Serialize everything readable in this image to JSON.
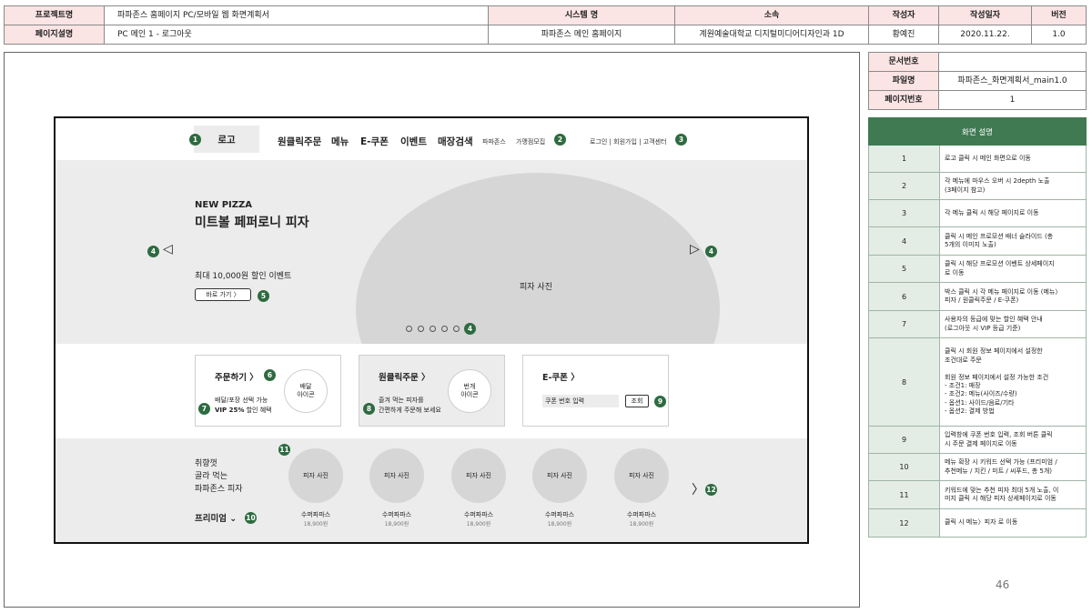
{
  "header": {
    "project_label": "프로젝트명",
    "project_value": "파파존스 홈페이지 PC/모바일 웹 화면계획서",
    "system_label": "시스템 명",
    "org_label": "소속",
    "author_label": "작성자",
    "date_label": "작성일자",
    "version_label": "버전",
    "page_label": "페이지설명",
    "page_value": "PC 메인 1 - 로그아웃",
    "system_value": "파파존스 메인 홈페이지",
    "org_value": "계원예술대학교 디지털미디어디자인과 1D",
    "author_value": "황예진",
    "date_value": "2020.11.22.",
    "version_value": "1.0"
  },
  "docinfo": {
    "doc_no_label": "문서번호",
    "doc_no_value": "",
    "file_label": "파일명",
    "file_value": "파파존스_화면계획서_main1.0",
    "page_no_label": "페이지번호",
    "page_no_value": "1"
  },
  "wireframe": {
    "nav": {
      "logo": "로고",
      "items": [
        "원클릭주문",
        "메뉴",
        "E-쿠폰",
        "이벤트",
        "매장검색"
      ],
      "small": [
        "파파존스",
        "가맹점모집"
      ],
      "util": "로그인 | 회원가입 | 고객센터"
    },
    "hero": {
      "kicker": "NEW PIZZA",
      "title": "미트볼 페퍼로니 피자",
      "subtitle": "최대 10,000원 할인 이벤트",
      "button": "바로 가기 〉",
      "photo": "피자 사진",
      "prev_arrow": "◁",
      "next_arrow": "▷"
    },
    "cards": {
      "order_title": "주문하기",
      "order_line1": "배달/포장 선택 가능",
      "order_vip": "VIP 25%",
      "order_line2_rest": " 할인 혜택",
      "order_icon": "배달\n아이콘",
      "oneclick_title": "원클릭주문",
      "oneclick_line1": "즐겨 먹는 피자를",
      "oneclick_line2": "간편하게 주문해 보세요",
      "oneclick_icon": "번개\n아이콘",
      "coupon_title": "E-쿠폰",
      "coupon_placeholder": "쿠폰 번호 입력",
      "coupon_button": "조회",
      "chevron": "〉"
    },
    "recommend": {
      "heading_lines": [
        "취향껏",
        "골라 먹는",
        "파파존스 피자"
      ],
      "filter": "프리미엄",
      "filter_arrow": "⌄",
      "next": "〉",
      "products": [
        {
          "photo": "피자 사진",
          "name": "수퍼파파스",
          "price": "18,900원"
        },
        {
          "photo": "피자 사진",
          "name": "수퍼파파스",
          "price": "18,900원"
        },
        {
          "photo": "피자 사진",
          "name": "수퍼파파스",
          "price": "18,900원"
        },
        {
          "photo": "피자 사진",
          "name": "수퍼파파스",
          "price": "18,900원"
        },
        {
          "photo": "피자 사진",
          "name": "수퍼파파스",
          "price": "18,900원"
        }
      ]
    },
    "badges": [
      "1",
      "2",
      "3",
      "4",
      "4",
      "4",
      "5",
      "6",
      "7",
      "8",
      "9",
      "10",
      "11",
      "12"
    ]
  },
  "description": {
    "title": "화면 설명",
    "rows": [
      {
        "no": "1",
        "text": "로고 클릭 시 메인 화면으로 이동"
      },
      {
        "no": "2",
        "text": "각 메뉴에 마우스 오버 시 2depth 노출\n(3페이지 참고)"
      },
      {
        "no": "3",
        "text": "각 메뉴 클릭 시 해당 페이지로 이동"
      },
      {
        "no": "4",
        "text": "클릭 시 메인 프로모션 배너 슬라이드 (총\n5개의 이미지 노출)"
      },
      {
        "no": "5",
        "text": "클릭 시 해당 프로모션 이벤트 상세페이지\n로 이동"
      },
      {
        "no": "6",
        "text": "박스 클릭 시 각 메뉴 페이지로 이동 (메뉴〉\n피자 / 원클릭주문 / E-쿠폰)"
      },
      {
        "no": "7",
        "text": "사용자의 등급에 맞는 할인 혜택 안내\n(로그아웃 시 VIP 등급 기준)"
      },
      {
        "no": "8",
        "text": "클릭 시 회원 정보 페이지에서 설정한\n조건대로 주문\n\n회원 정보 페이지에서 설정 가능한 조건\n-      조건1: 매장\n-      조건2: 메뉴(사이즈/수량)\n-      옵션1: 사이드/음료/기타\n-      옵션2: 결제 방법"
      },
      {
        "no": "9",
        "text": "입력창에 쿠폰 번호 입력, 조회 버튼 클릭\n시 주문 결제 페이지로 이동"
      },
      {
        "no": "10",
        "text": "메뉴 확장 시 키워드 선택 가능 (프리미엄 /\n추천메뉴 / 치킨 / 미트 / 씨푸드, 총 5개)"
      },
      {
        "no": "11",
        "text": "키워드에 맞는 추천 피자 최대 5개 노출, 이\n미지 클릭 시 해당 피자 상세페이지로 이동"
      },
      {
        "no": "12",
        "text": "클릭 시 메뉴〉피자 로 이동"
      }
    ]
  },
  "page_number": "46",
  "colors": {
    "accent": "#2e6b40",
    "label_bg": "#fbe4e4",
    "desc_header": "#3f7a52",
    "desc_num_bg": "#e3ece5"
  }
}
